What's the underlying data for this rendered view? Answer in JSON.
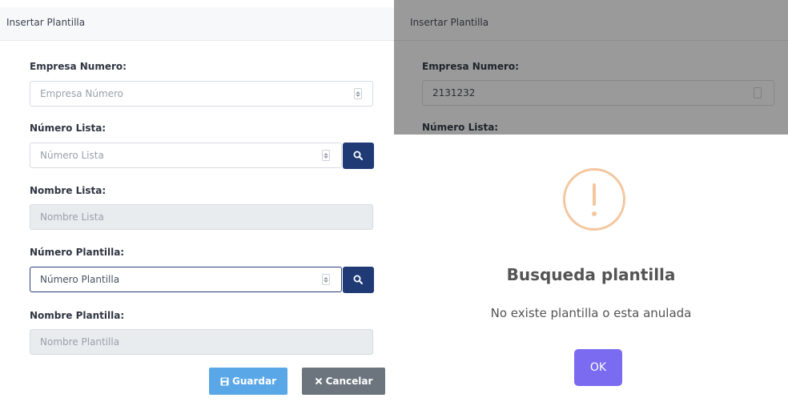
{
  "form": {
    "header_title": "Insertar Plantilla",
    "empresa_label": "Empresa Numero:",
    "empresa_placeholder": "Empresa Número",
    "numero_lista_label": "Número Lista:",
    "numero_lista_placeholder": "Número Lista",
    "nombre_lista_label": "Nombre Lista:",
    "nombre_lista_placeholder": "Nombre Lista",
    "numero_plantilla_label": "Número Plantilla:",
    "numero_plantilla_placeholder": "Número Plantilla",
    "nombre_plantilla_label": "Nombre Plantilla:",
    "nombre_plantilla_placeholder": "Nombre Plantilla",
    "save_label": "Guardar",
    "cancel_label": "Cancelar"
  },
  "background_form": {
    "header_title": "Insertar Plantilla",
    "empresa_label": "Empresa Numero:",
    "empresa_value": "2131232",
    "numero_lista_label": "Número Lista:"
  },
  "alert": {
    "icon": "warning-icon",
    "title": "Busqueda plantilla",
    "message": "No existe plantilla o esta anulada",
    "ok_label": "OK"
  },
  "colors": {
    "search_button": "#1f3a75",
    "save_button": "#5aa7e8",
    "cancel_button": "#6c757d",
    "ok_button": "#7a6bf0",
    "warning": "#f4c69e"
  }
}
